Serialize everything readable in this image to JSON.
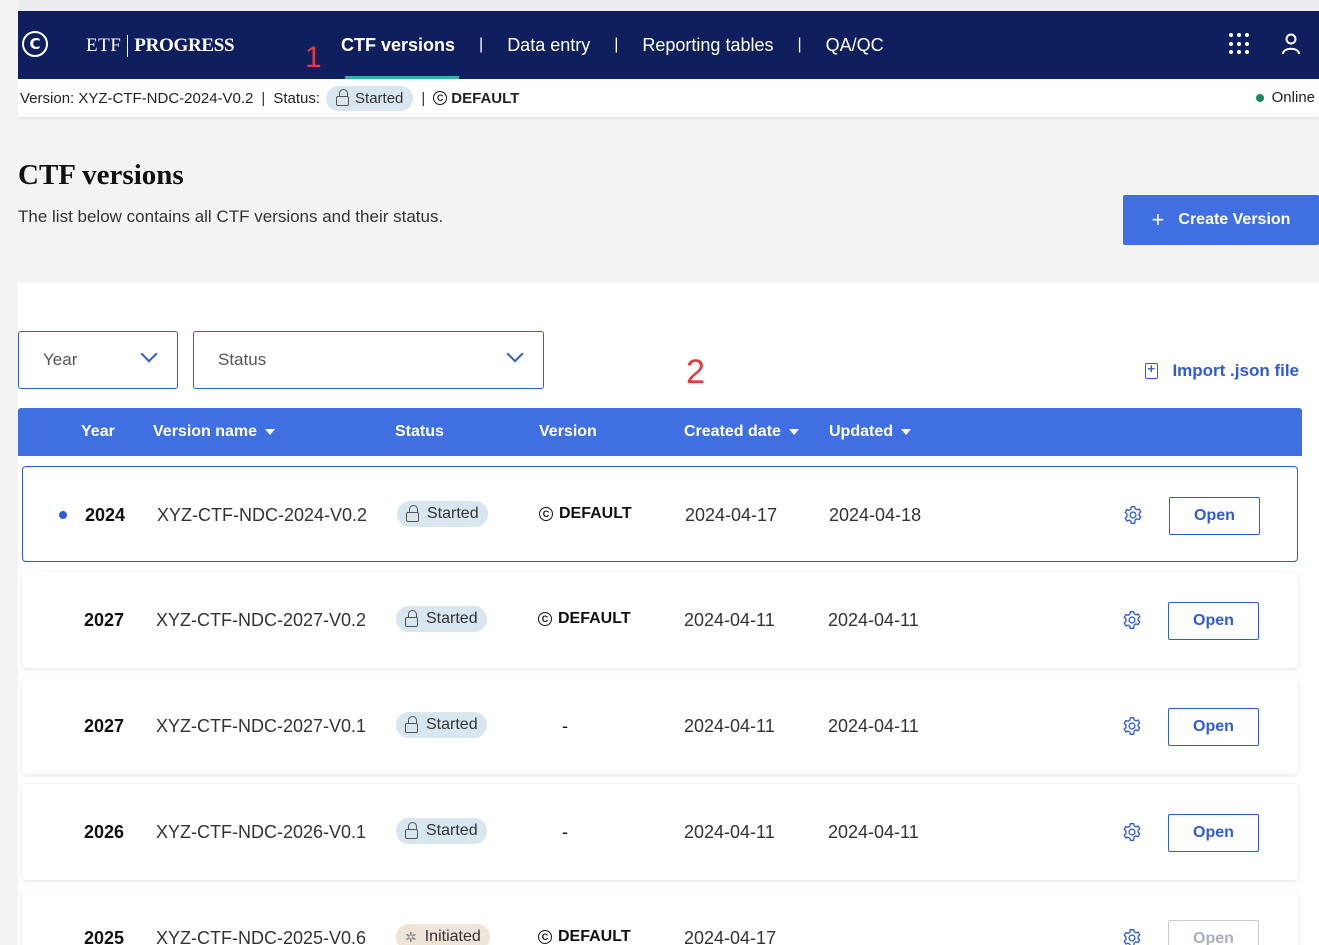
{
  "nav": {
    "logo_glyph": "C",
    "brand_left": "ETF",
    "brand_right": "PROGRESS",
    "marker": "1",
    "tabs": [
      {
        "label": "CTF versions",
        "active": true
      },
      {
        "label": "Data entry",
        "active": false
      },
      {
        "label": "Reporting tables",
        "active": false
      },
      {
        "label": "QA/QC",
        "active": false
      }
    ],
    "divider": "|"
  },
  "status_bar": {
    "version_text": "Version: XYZ-CTF-NDC-2024-V0.2",
    "separator": "|",
    "status_label": "Status:",
    "status_value": "Started",
    "default_label": "DEFAULT",
    "online_label": "Online"
  },
  "header": {
    "title": "CTF versions",
    "subtitle": "The list below contains all CTF versions and their status.",
    "create_button": "Create Version",
    "create_plus": "+"
  },
  "filters": {
    "year_placeholder": "Year",
    "status_placeholder": "Status",
    "marker": "2",
    "import_label": "Import .json file"
  },
  "table": {
    "columns": {
      "year": "Year",
      "version_name": "Version name",
      "status": "Status",
      "version": "Version",
      "created": "Created date",
      "updated": "Updated"
    },
    "rows": [
      {
        "year": "2024",
        "name": "XYZ-CTF-NDC-2024-V0.2",
        "status": "Started",
        "version": "DEFAULT",
        "created": "2024-04-17",
        "updated": "2024-04-18",
        "open": "Open"
      },
      {
        "year": "2027",
        "name": "XYZ-CTF-NDC-2027-V0.2",
        "status": "Started",
        "version": "DEFAULT",
        "created": "2024-04-11",
        "updated": "2024-04-11",
        "open": "Open"
      },
      {
        "year": "2027",
        "name": "XYZ-CTF-NDC-2027-V0.1",
        "status": "Started",
        "version": "-",
        "created": "2024-04-11",
        "updated": "2024-04-11",
        "open": "Open"
      },
      {
        "year": "2026",
        "name": "XYZ-CTF-NDC-2026-V0.1",
        "status": "Started",
        "version": "-",
        "created": "2024-04-11",
        "updated": "2024-04-11",
        "open": "Open"
      },
      {
        "year": "2025",
        "name": "XYZ-CTF-NDC-2025-V0.6",
        "status": "Initiated",
        "version": "DEFAULT",
        "created": "2024-04-17",
        "updated": "",
        "open": "Open"
      }
    ]
  },
  "colors": {
    "nav_bg": "#0f1f5e",
    "primary": "#3f6fe0",
    "active_underline": "#3ab0a0",
    "online_green": "#1a8a5b",
    "marker_red": "#e23b3b"
  }
}
